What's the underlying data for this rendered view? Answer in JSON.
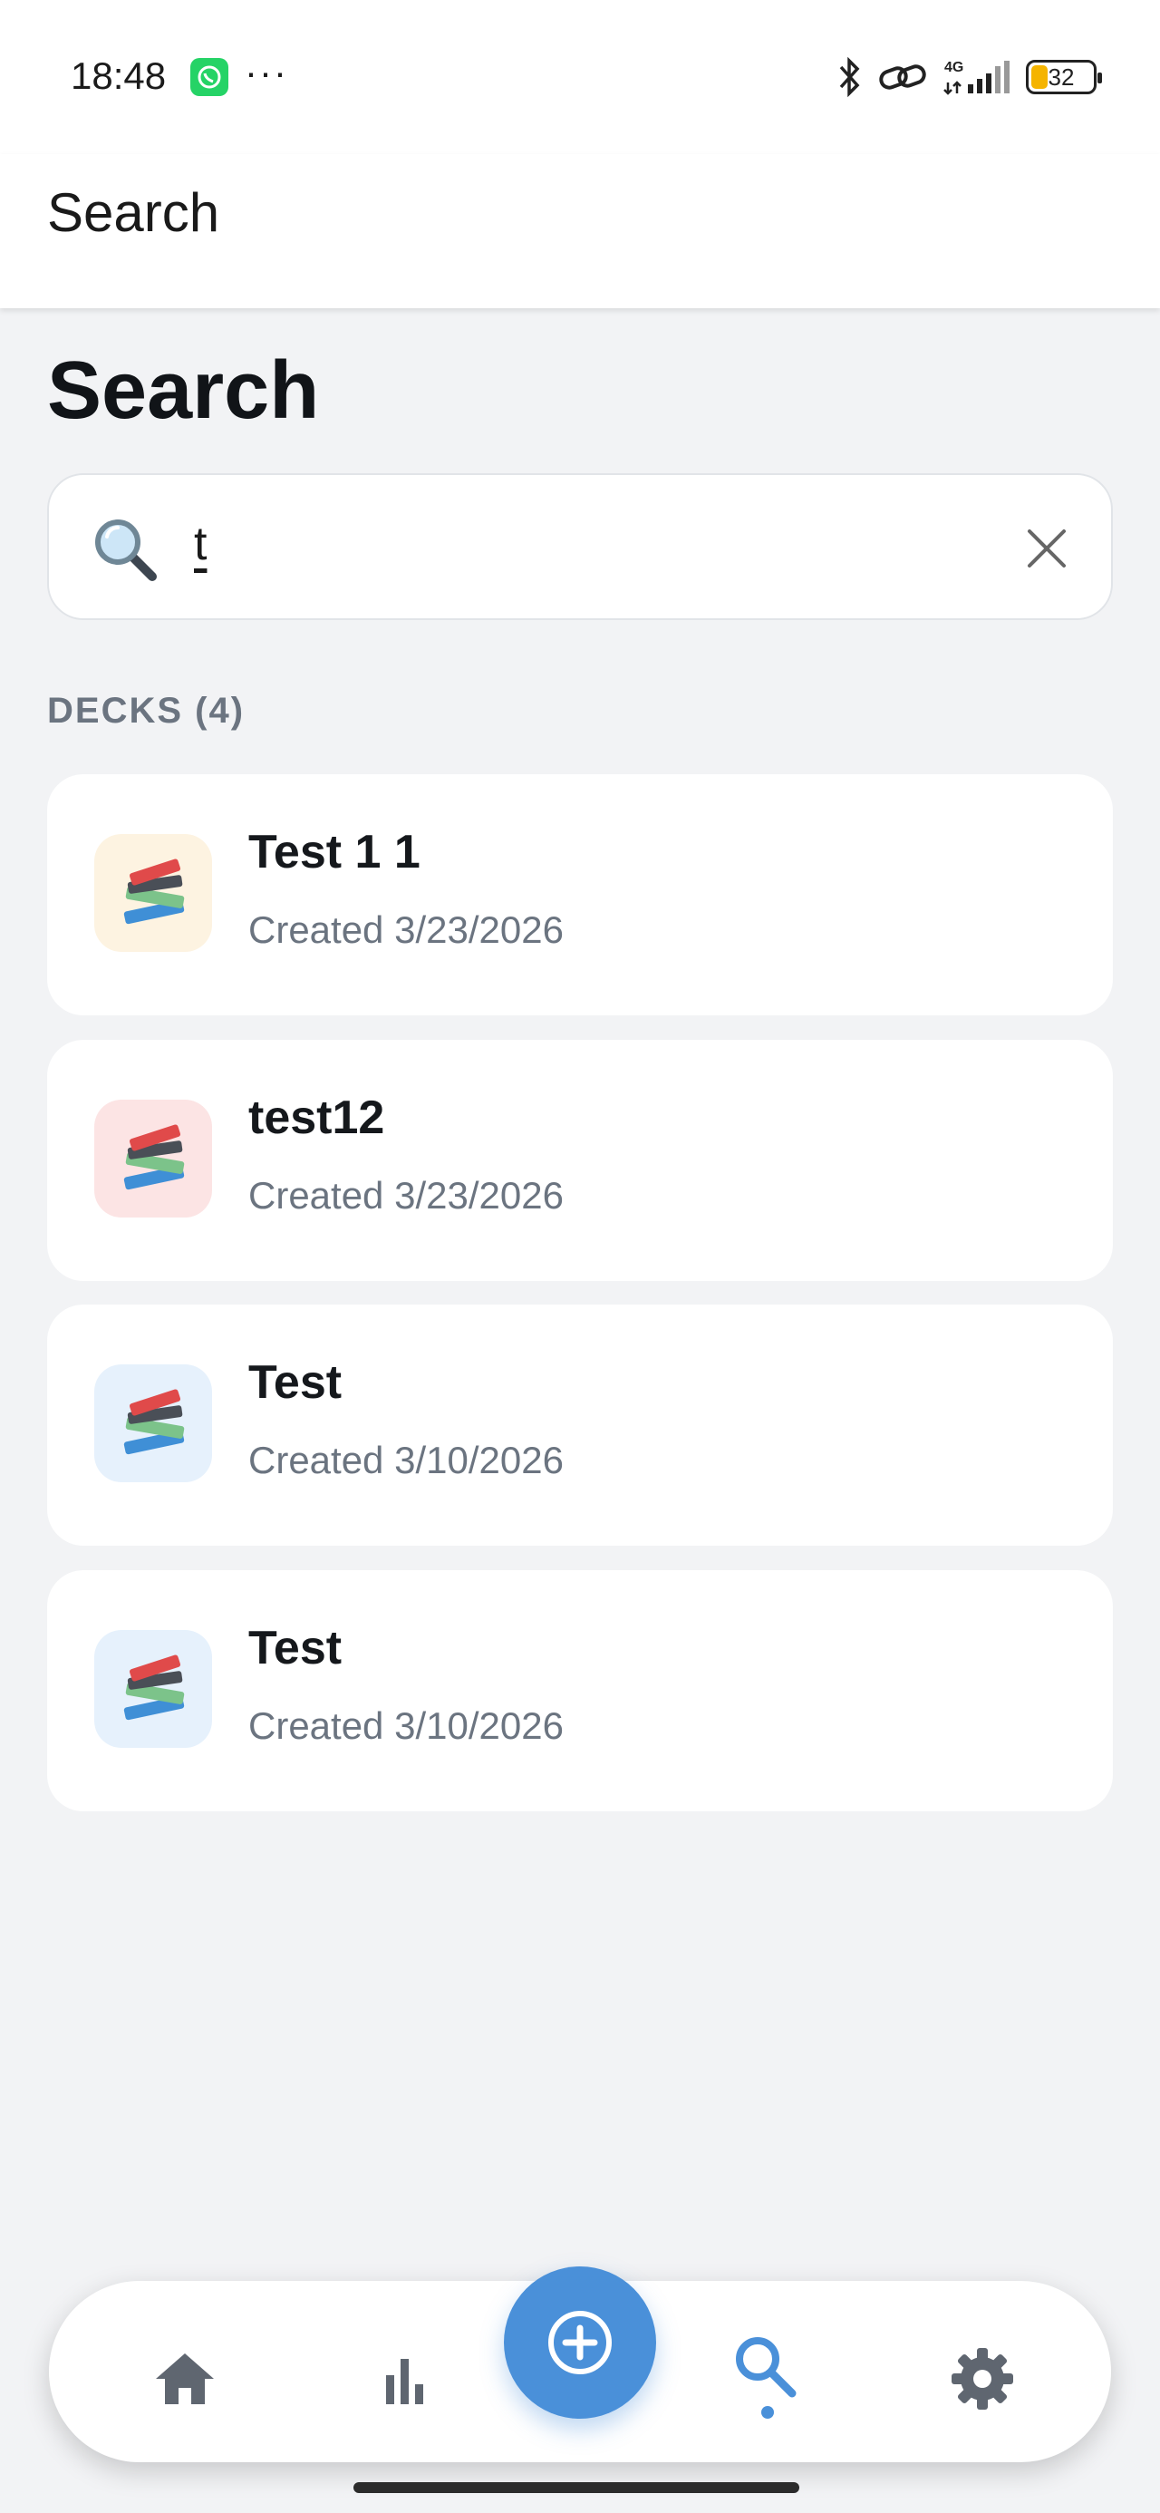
{
  "status_bar": {
    "time": "18:48",
    "dots": "···",
    "battery_level": "32",
    "network": "4G",
    "icons": [
      "whatsapp-icon",
      "bluetooth-icon",
      "link-icon",
      "signal-icon",
      "battery-icon"
    ]
  },
  "app_bar": {
    "title": "Search"
  },
  "page": {
    "heading": "Search"
  },
  "search": {
    "value": "t",
    "icons": [
      "magnifier-emoji-icon",
      "clear-x-icon"
    ]
  },
  "results": {
    "section_label": "DECKS (4)",
    "decks": [
      {
        "title": "Test 1 1",
        "date": "Created 3/23/2026",
        "icon_bg": "#fdf3e1",
        "icon": "books-icon"
      },
      {
        "title": "test12",
        "date": "Created 3/23/2026",
        "icon_bg": "#fce4e4",
        "icon": "books-icon"
      },
      {
        "title": "Test",
        "date": "Created 3/10/2026",
        "icon_bg": "#e6f1fc",
        "icon": "books-icon"
      },
      {
        "title": "Test",
        "date": "Created 3/10/2026",
        "icon_bg": "#e6f1fc",
        "icon": "books-icon"
      }
    ]
  },
  "bottom_nav": {
    "items": [
      "home-icon",
      "stats-icon",
      "add-icon",
      "search-icon",
      "settings-icon"
    ],
    "active": "search-icon",
    "accent": "#4a90d9"
  }
}
